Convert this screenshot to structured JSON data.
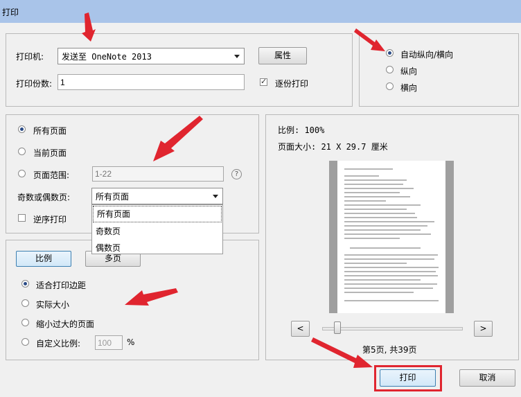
{
  "window": {
    "title": "打印"
  },
  "printer": {
    "label": "打印机:",
    "selected": "发送至 OneNote 2013",
    "properties_label": "属性",
    "copies_label": "打印份数:",
    "copies_value": "1",
    "collate_label": "逐份打印",
    "collate_checked": true
  },
  "orientation": {
    "options": [
      "自动纵向/横向",
      "纵向",
      "横向"
    ],
    "selected": "自动纵向/横向"
  },
  "range": {
    "options": [
      "所有页面",
      "当前页面",
      "页面范围:"
    ],
    "selected": "所有页面",
    "page_range_placeholder": "1-22",
    "help_label": "?",
    "odd_even_label": "奇数或偶数页:",
    "odd_even_selected": "所有页面",
    "odd_even_options": [
      "所有页面",
      "奇数页",
      "偶数页"
    ],
    "reverse_label": "逆序打印",
    "reverse_checked": false
  },
  "scaling": {
    "tabs": [
      "比例",
      "多页"
    ],
    "active_tab": "比例",
    "options": [
      "适合打印边距",
      "实际大小",
      "缩小过大的页面",
      "自定义比例:"
    ],
    "selected": "适合打印边距",
    "custom_value": "100",
    "custom_unit": "%"
  },
  "preview": {
    "scale_text": "比例: 100%",
    "page_size_text": "页面大小: 21 X 29.7 厘米",
    "prev_label": "<",
    "next_label": ">",
    "slider_position": 0.06,
    "page_status": "第5页, 共39页"
  },
  "actions": {
    "print_label": "打印",
    "cancel_label": "取消"
  },
  "colors": {
    "annotation_red": "#e0252f",
    "titlebar": "#a9c4e9"
  }
}
